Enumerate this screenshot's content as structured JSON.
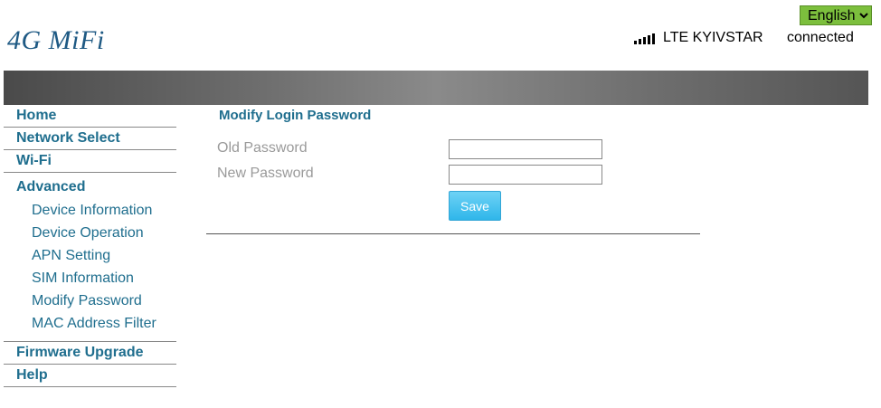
{
  "header": {
    "logo": "4G MiFi",
    "language": "English",
    "language_options": [
      "English"
    ],
    "network": "LTE KYIVSTAR",
    "status": "connected",
    "signal_bars": 5
  },
  "sidebar": {
    "items": [
      {
        "label": "Home"
      },
      {
        "label": "Network Select"
      },
      {
        "label": "Wi-Fi"
      },
      {
        "label": "Advanced"
      }
    ],
    "advanced_sub": [
      {
        "label": "Device Information"
      },
      {
        "label": "Device Operation"
      },
      {
        "label": "APN Setting"
      },
      {
        "label": "SIM Information"
      },
      {
        "label": "Modify Password"
      },
      {
        "label": "MAC Address Filter"
      }
    ],
    "bottom_items": [
      {
        "label": "Firmware Upgrade"
      },
      {
        "label": "Help"
      }
    ]
  },
  "form": {
    "title": "Modify Login Password",
    "old_password_label": "Old Password",
    "old_password_value": "",
    "new_password_label": "New Password",
    "new_password_value": "",
    "save_label": "Save"
  },
  "colors": {
    "nav_text": "#1f6e8e",
    "logo": "#1f5a84",
    "language_bg": "#7cbf3d",
    "save_button": "#2fb6ea"
  }
}
